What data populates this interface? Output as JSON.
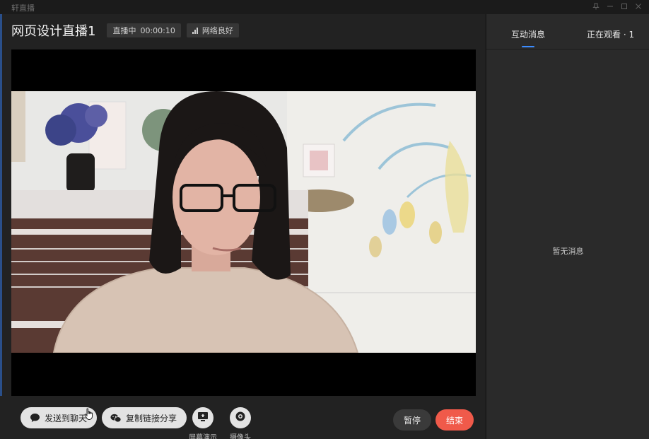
{
  "window": {
    "app_title": "轩直播",
    "controls": [
      "pin-icon",
      "minimize-icon",
      "maximize-icon",
      "close-icon"
    ]
  },
  "header": {
    "room_title": "网页设计直播1",
    "live_status": "直播中",
    "elapsed_time": "00:00:10",
    "network_status": "网络良好"
  },
  "controls": {
    "send_to_chat": "发送到聊天",
    "copy_link_share": "复制链接分享",
    "screen_share": "屏幕演示",
    "camera": "摄像头",
    "pause": "暂停",
    "end": "结束"
  },
  "sidebar": {
    "tabs": [
      {
        "label": "互动消息",
        "active": true
      },
      {
        "label": "正在观看 · 1",
        "active": false
      }
    ],
    "empty_message": "暂无消息"
  },
  "colors": {
    "accent": "#3c8cff",
    "end_button": "#f05a4a",
    "panel": "#2a2a2a",
    "background": "#222222"
  },
  "icons": {
    "send_to_chat": "chat-bubble-icon",
    "copy_link_share": "wechat-icon",
    "screen_share": "monitor-share-icon",
    "camera": "camera-icon",
    "network": "signal-bars-icon"
  }
}
